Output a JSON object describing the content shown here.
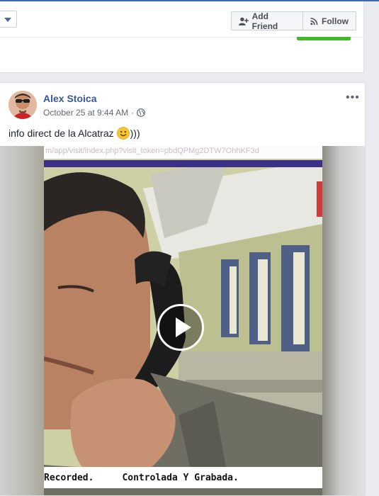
{
  "header_card": {
    "add_friend_label": "Add Friend",
    "follow_label": "Follow"
  },
  "post": {
    "author": "Alex Stoica",
    "timestamp": "October 25 at 9:44 AM",
    "separator": "·",
    "audience_icon": "globe-icon",
    "text_before_emoji": "info direct de la Alcatraz",
    "emoji": "smiley-emoji",
    "text_after_emoji": ")))",
    "more_label": "•••"
  },
  "video": {
    "url_fragment": "m/app/visit/index.php?visit_token=pbdQPMg2DTW7OhhKF3d",
    "caption_left": "Recorded.",
    "caption_right": "Controlada Y Grabada.",
    "play_icon": "play-icon"
  },
  "colors": {
    "link_blue": "#365899",
    "accent_green": "#42b72a",
    "page_bg": "#e9ebee"
  }
}
